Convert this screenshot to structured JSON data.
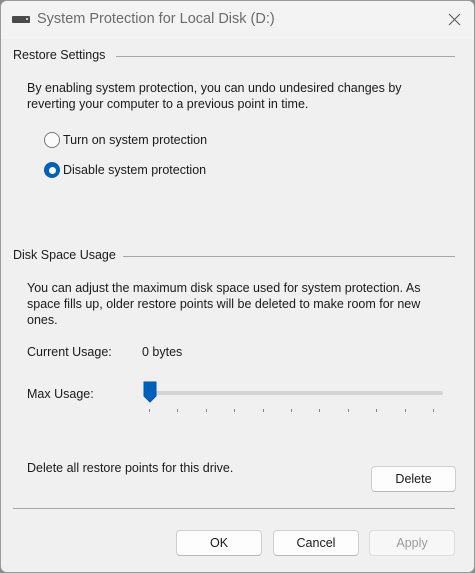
{
  "window": {
    "title": "System Protection for Local Disk (D:)",
    "icon": "drive-icon",
    "close_icon": "close-icon"
  },
  "restore_settings": {
    "label": "Restore Settings",
    "description_line1": "By enabling system protection, you can undo undesired changes by",
    "description_line2": "reverting your computer to a previous point in time.",
    "options": [
      {
        "label": "Turn on system protection",
        "checked": false
      },
      {
        "label": "Disable system protection",
        "checked": true
      }
    ]
  },
  "disk_space": {
    "label": "Disk Space Usage",
    "description_line1": "You can adjust the maximum disk space used for system protection. As",
    "description_line2": "space fills up, older restore points will be deleted to make room for new",
    "description_line3": "ones.",
    "current_usage_label": "Current Usage:",
    "current_usage_value": "0 bytes",
    "max_usage_label": "Max Usage:",
    "max_usage_percent": 0,
    "delete_text": "Delete all restore points for this drive.",
    "delete_button": "Delete"
  },
  "footer": {
    "ok": "OK",
    "cancel": "Cancel",
    "apply": "Apply",
    "apply_enabled": false
  },
  "colors": {
    "accent": "#0061b8",
    "background": "#f0f0f0"
  }
}
